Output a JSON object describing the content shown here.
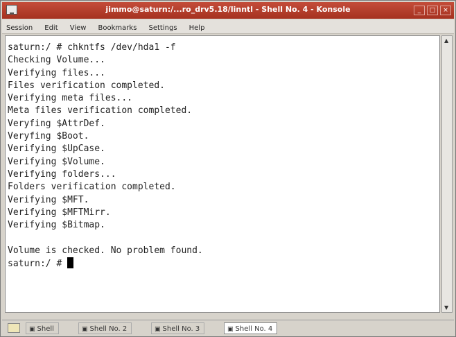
{
  "window": {
    "title": "jimmo@saturn:/...ro_drv5.18/linntl - Shell No. 4 - Konsole"
  },
  "menu": [
    "Session",
    "Edit",
    "View",
    "Bookmarks",
    "Settings",
    "Help"
  ],
  "terminal": {
    "lines": [
      "saturn:/ # chkntfs /dev/hda1 -f",
      "Checking Volume...",
      "Verifying files...",
      "Files verification completed.",
      "Verifying meta files...",
      "Meta files verification completed.",
      "Veryfing $AttrDef.",
      "Veryfing $Boot.",
      "Verifying $UpCase.",
      "Verifying $Volume.",
      "Verifying folders...",
      "Folders verification completed.",
      "Verifying $MFT.",
      "Verifying $MFTMirr.",
      "Verifying $Bitmap.",
      "",
      "Volume is checked. No problem found.",
      "saturn:/ # "
    ]
  },
  "tabs": [
    "Shell",
    "Shell No. 2",
    "Shell No. 3",
    "Shell No. 4"
  ],
  "colors": {
    "titlebar": "#b33d2a",
    "chrome": "#d7d3cb",
    "terminal_bg": "#ffffff",
    "terminal_fg": "#222222"
  },
  "icons": {
    "window": "terminal-icon",
    "tab": "shell-tab-icon"
  }
}
